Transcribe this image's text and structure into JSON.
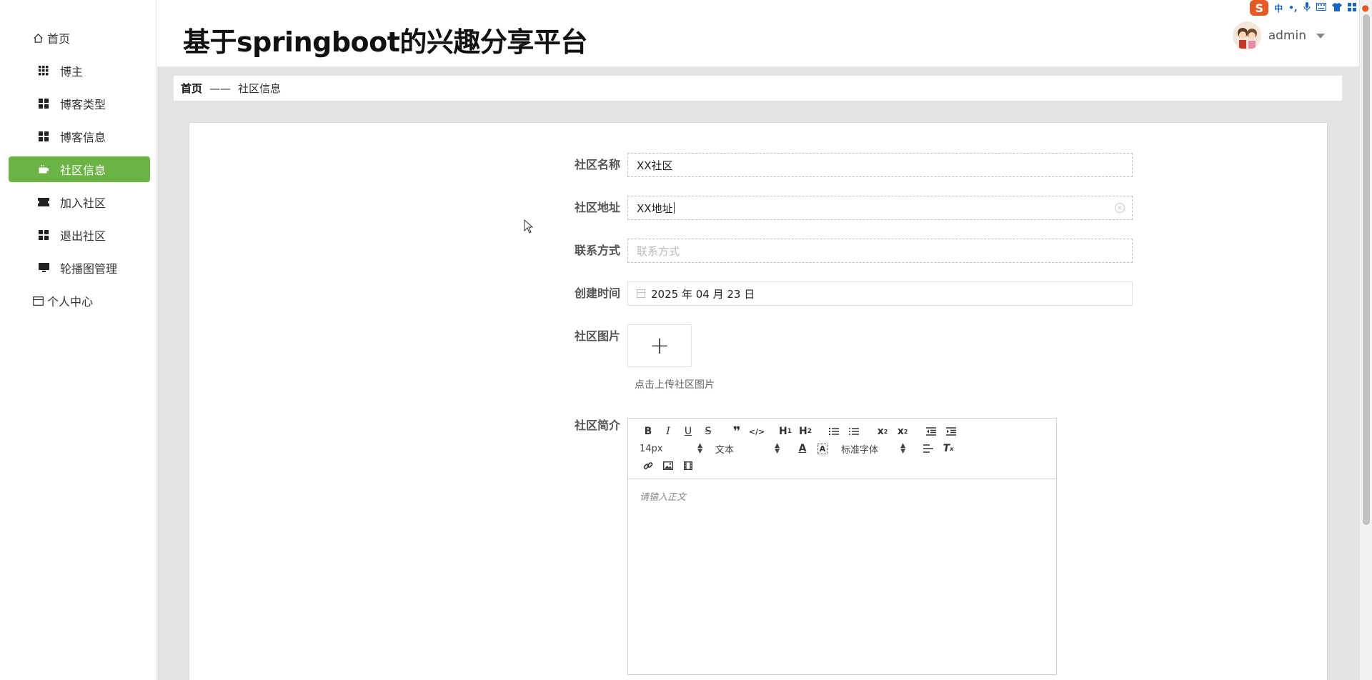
{
  "app": {
    "title": "基于springboot的兴趣分享平台"
  },
  "sidebar": {
    "items": [
      {
        "label": "首页",
        "icon": "home-icon"
      },
      {
        "label": "博主",
        "icon": "grid-icon"
      },
      {
        "label": "博客类型",
        "icon": "grid-icon"
      },
      {
        "label": "博客信息",
        "icon": "grid-icon"
      },
      {
        "label": "社区信息",
        "icon": "coffee-icon",
        "active": true
      },
      {
        "label": "加入社区",
        "icon": "ticket-icon"
      },
      {
        "label": "退出社区",
        "icon": "grid-icon"
      },
      {
        "label": "轮播图管理",
        "icon": "monitor-icon"
      },
      {
        "label": "个人中心",
        "icon": "card-icon"
      }
    ]
  },
  "header": {
    "username": "admin"
  },
  "breadcrumb": {
    "home": "首页",
    "separator": "——",
    "current": "社区信息"
  },
  "form": {
    "name": {
      "label": "社区名称",
      "value": "XX社区"
    },
    "address": {
      "label": "社区地址",
      "value": "XX地址"
    },
    "contact": {
      "label": "联系方式",
      "placeholder": "联系方式"
    },
    "created": {
      "label": "创建时间",
      "value": "2025 年 04 月 23 日"
    },
    "image": {
      "label": "社区图片",
      "upload_symbol": "+",
      "hint": "点击上传社区图片"
    },
    "intro": {
      "label": "社区简介",
      "font_size": "14px",
      "paragraph": "文本",
      "font_family": "标准字体",
      "placeholder": "请输入正文"
    }
  },
  "tray": {
    "lang": "中"
  },
  "colors": {
    "accent": "#6ab344",
    "breadcrumb_bg": "#e4e4e4"
  }
}
